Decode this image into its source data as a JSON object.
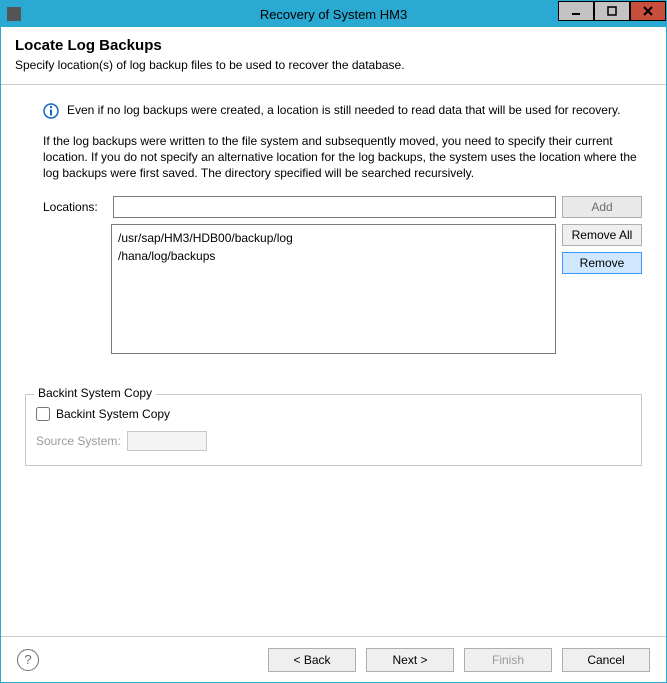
{
  "window": {
    "title": "Recovery of System HM3"
  },
  "header": {
    "title": "Locate Log Backups",
    "subtitle": "Specify location(s) of log backup files to be used to recover the database."
  },
  "info": {
    "text": "Even if no log backups were created, a location is still needed to read data that will be used for recovery."
  },
  "explain": "If the log backups were written to the file system and subsequently moved, you need to specify their current location. If you do not specify an alternative location for the log backups, the system uses the location where the log backups were first saved. The directory specified will be searched recursively.",
  "locations": {
    "label": "Locations:",
    "input_value": "",
    "add_label": "Add",
    "list": {
      "0": "/usr/sap/HM3/HDB00/backup/log",
      "1": "/hana/log/backups"
    },
    "remove_all_label": "Remove All",
    "remove_label": "Remove"
  },
  "backint": {
    "legend": "Backint System Copy",
    "checkbox_label": "Backint System Copy",
    "source_label": "Source System:",
    "source_value": ""
  },
  "footer": {
    "back": "< Back",
    "next": "Next >",
    "finish": "Finish",
    "cancel": "Cancel"
  }
}
